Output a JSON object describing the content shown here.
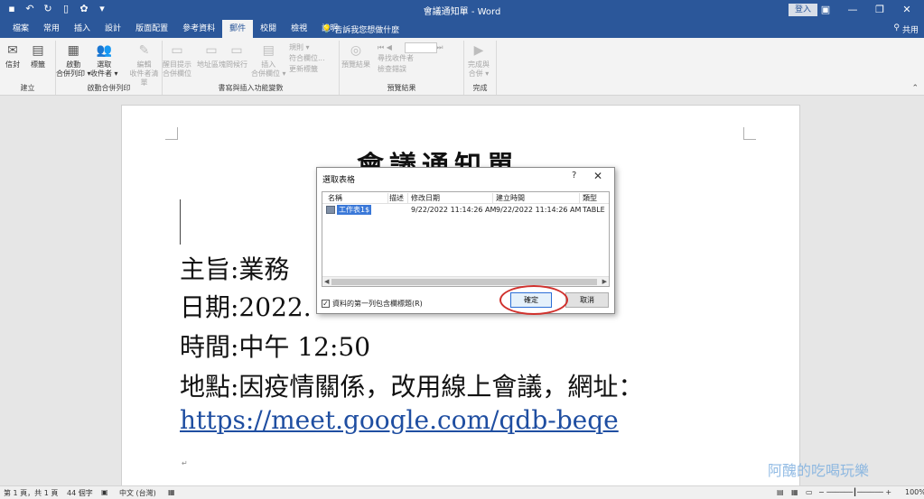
{
  "window": {
    "doc_title": "會議通知單 - Word",
    "login_label": "登入",
    "minimize": "—",
    "restore": "❐",
    "close": "✕"
  },
  "tabs": [
    "檔案",
    "常用",
    "插入",
    "設計",
    "版面配置",
    "參考資料",
    "郵件",
    "校閱",
    "檢視",
    "說明"
  ],
  "active_tab": "郵件",
  "tell_me": "告訴我您想做什麼",
  "share": "共用",
  "ribbon": {
    "group_create": {
      "label": "建立",
      "envelopes": "信封",
      "labels": "標籤"
    },
    "group_start": {
      "label": "啟動合併列印",
      "start_line1": "啟動",
      "start_line2": "合併列印 ▾",
      "select_line1": "選取",
      "select_line2": "收件者 ▾",
      "edit_line1": "編輯",
      "edit_line2": "收件者清單"
    },
    "group_write": {
      "label": "書寫與插入功能變數",
      "highlight_line1": "醒目提示",
      "highlight_line2": "合併欄位",
      "address": "地址區塊",
      "greeting": "問候行",
      "insert_line1": "插入",
      "insert_line2": "合併欄位 ▾",
      "rules": "規則 ▾",
      "match": "符合欄位...",
      "update": "更新標籤"
    },
    "group_preview": {
      "label": "預覽結果",
      "preview": "預覽結果",
      "find": "尋找收件者",
      "check": "檢查錯誤"
    },
    "group_finish": {
      "label": "完成",
      "finish_line1": "完成與",
      "finish_line2": "合併 ▾"
    }
  },
  "document": {
    "heading": "會議通知單",
    "line_subject": "主旨:業務",
    "line_date": "日期:2022.",
    "line_time": "時間:中午 12:50",
    "line_place": "地點:因疫情關係，改用線上會議，網址：",
    "link": "https://meet.google.com/qdb-beqe"
  },
  "dialog": {
    "title": "選取表格",
    "help": "?",
    "close": "✕",
    "columns": [
      "名稱",
      "描述",
      "修改日期",
      "建立時間",
      "類型"
    ],
    "rows": [
      {
        "name": "工作表1$",
        "desc": "",
        "modified": "9/22/2022 11:14:26 AM",
        "created": "9/22/2022 11:14:26 AM",
        "type": "TABLE"
      }
    ],
    "first_row_header_label": "資料的第一列包含欄標題(R)",
    "first_row_header_checked": true,
    "ok_label": "確定",
    "cancel_label": "取消"
  },
  "status": {
    "page": "第 1 頁，共 1 頁",
    "words": "44 個字",
    "language": "中文 (台灣)",
    "zoom": "100%"
  },
  "watermark": "阿醜的吃喝玩樂",
  "colors": {
    "brand": "#2b579a",
    "annotation": "#d0312d",
    "selection": "#3a78d8"
  }
}
